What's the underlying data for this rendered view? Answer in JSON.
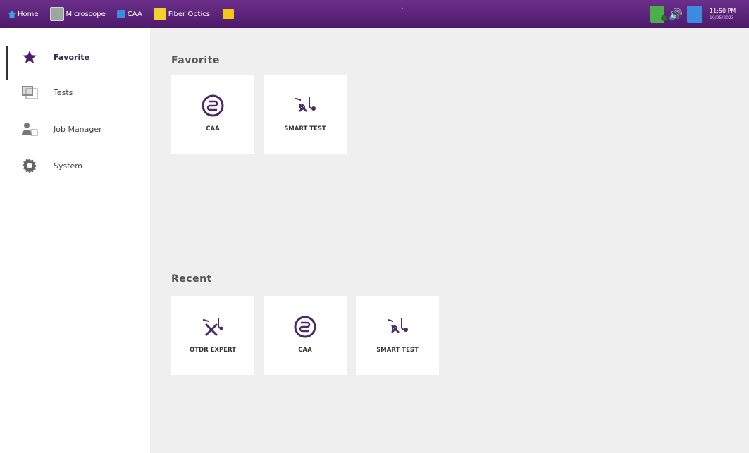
{
  "taskbar": {
    "tabs": [
      {
        "label": "Home",
        "icon": "home-icon"
      },
      {
        "label": "Microscope",
        "icon": "microscope-icon"
      },
      {
        "label": "CAA",
        "icon": "caa-icon"
      },
      {
        "label": "Fiber Optics",
        "icon": "fiber-optics-icon"
      }
    ],
    "time": "11:50 PM",
    "date": "10/25/2023",
    "accent": "#5a2277"
  },
  "sidebar": {
    "items": [
      {
        "label": "Favorite",
        "icon": "star-icon",
        "active": true
      },
      {
        "label": "Tests",
        "icon": "tests-icon"
      },
      {
        "label": "Job Manager",
        "icon": "job-manager-icon"
      },
      {
        "label": "System",
        "icon": "gear-icon"
      }
    ]
  },
  "favorite": {
    "title": "Favorite",
    "tiles": [
      {
        "label": "CAA",
        "icon": "caa-circle-icon"
      },
      {
        "label": "SMART TEST",
        "icon": "smart-test-icon"
      }
    ]
  },
  "recent": {
    "title": "Recent",
    "tiles": [
      {
        "label": "OTDR EXPERT",
        "icon": "otdr-expert-icon"
      },
      {
        "label": "CAA",
        "icon": "caa-circle-icon"
      },
      {
        "label": "SMART TEST",
        "icon": "smart-test-icon"
      }
    ]
  },
  "colors": {
    "accent": "#5a2277",
    "icon_purple": "#4a2a6a"
  }
}
